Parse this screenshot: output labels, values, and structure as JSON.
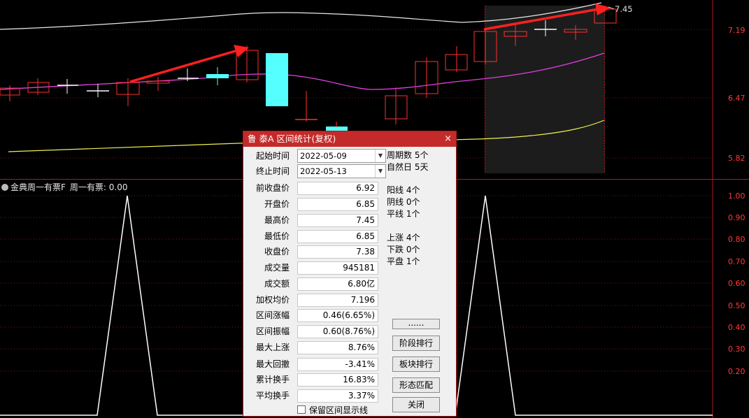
{
  "top_axis_labels": [
    "7.19",
    "6.47",
    "5.82"
  ],
  "price_tag": "7.45",
  "indicator": {
    "name": "金典周一有票F",
    "label": "周一有票:",
    "value": "0.00"
  },
  "bottom_axis_labels": [
    "1.00",
    "0.90",
    "0.80",
    "0.70",
    "0.60",
    "0.50",
    "0.40",
    "0.30",
    "0.20"
  ],
  "dialog": {
    "title": "鲁 泰A  区间统计(复权)",
    "close": "×",
    "start_label": "起始时间",
    "start_value": "2022-05-09",
    "end_label": "终止时间",
    "end_value": "2022-05-13",
    "fields": [
      {
        "label": "前收盘价",
        "value": "6.92"
      },
      {
        "label": "开盘价",
        "value": "6.85"
      },
      {
        "label": "最高价",
        "value": "7.45"
      },
      {
        "label": "最低价",
        "value": "6.85"
      },
      {
        "label": "收盘价",
        "value": "7.38"
      },
      {
        "label": "成交量",
        "value": "945181"
      },
      {
        "label": "成交额",
        "value": "6.80亿"
      },
      {
        "label": "加权均价",
        "value": "7.196"
      },
      {
        "label": "区间涨幅",
        "value": "0.46(6.65%)"
      },
      {
        "label": "区间振幅",
        "value": "0.60(8.76%)"
      },
      {
        "label": "最大上涨",
        "value": "8.76%"
      },
      {
        "label": "最大回撤",
        "value": "-3.41%"
      },
      {
        "label": "累计换手",
        "value": "16.83%"
      },
      {
        "label": "平均换手",
        "value": "3.37%"
      }
    ],
    "stats": [
      "周期数  5个",
      "自然日  5天",
      "阳线  4个",
      "阴线  0个",
      "平线  1个",
      "上涨  4个",
      "下跌  0个",
      "平盘  1个"
    ],
    "buttons": [
      "......",
      "阶段排行",
      "板块排行",
      "形态匹配",
      "关闭"
    ],
    "checkbox_label": "保留区间显示线"
  }
}
